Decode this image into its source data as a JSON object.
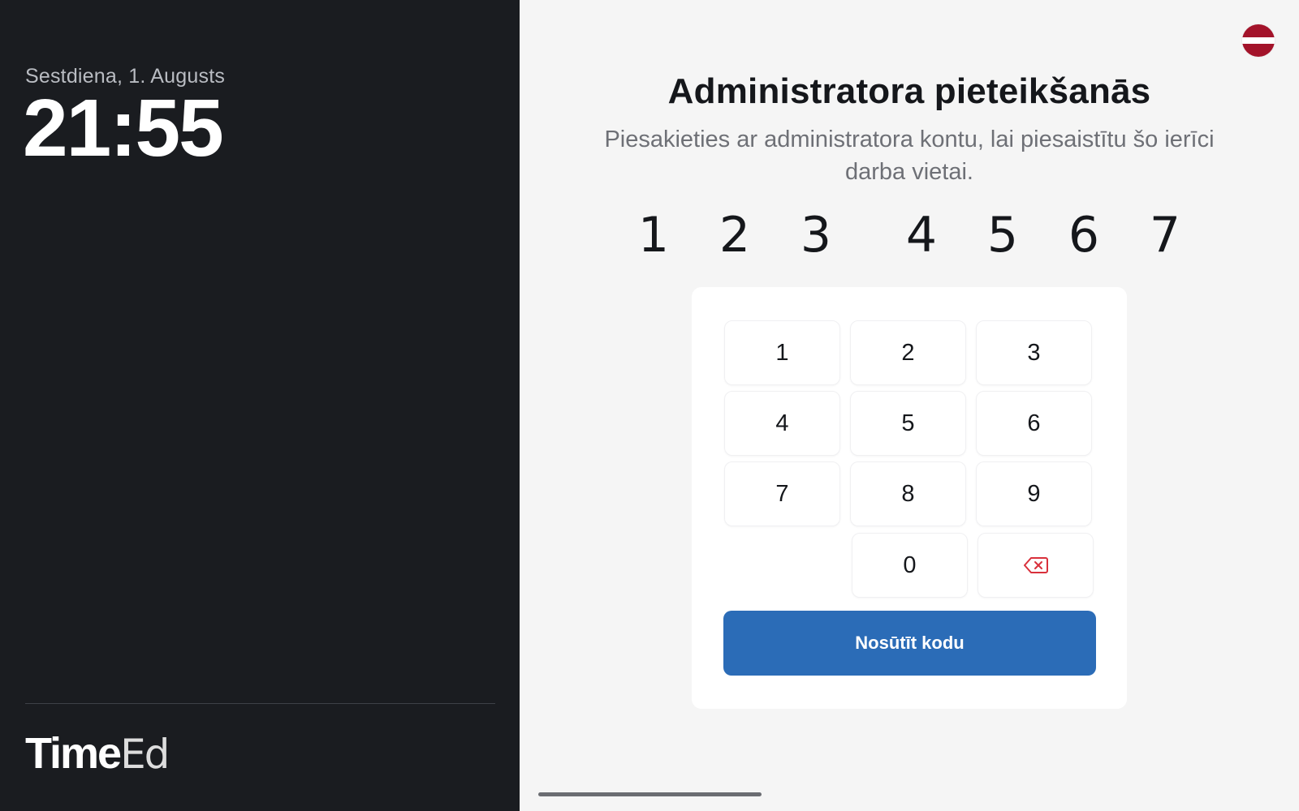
{
  "sidebar": {
    "date": "Sestdiena, 1. Augusts",
    "time": "21:55",
    "logo": {
      "bold": "Time",
      "thin": "Ed"
    }
  },
  "language": {
    "icon": "latvia-flag-icon",
    "colors": [
      "#a3132a",
      "#ffffff"
    ]
  },
  "login": {
    "title": "Administratora pieteikšanās",
    "subtitle": "Piesakieties ar administratora kontu, lai piesaistītu šo ierīci darba vietai.",
    "code": [
      "1",
      "2",
      "3",
      "4",
      "5",
      "6",
      "7"
    ],
    "keys": [
      "1",
      "2",
      "3",
      "4",
      "5",
      "6",
      "7",
      "8",
      "9",
      "0"
    ],
    "delete_icon": "backspace-icon",
    "submit_label": "Nosūtīt kodu"
  },
  "colors": {
    "accent": "#2b6cb7",
    "sidebar_bg": "#1a1c20",
    "delete": "#d9303b"
  }
}
